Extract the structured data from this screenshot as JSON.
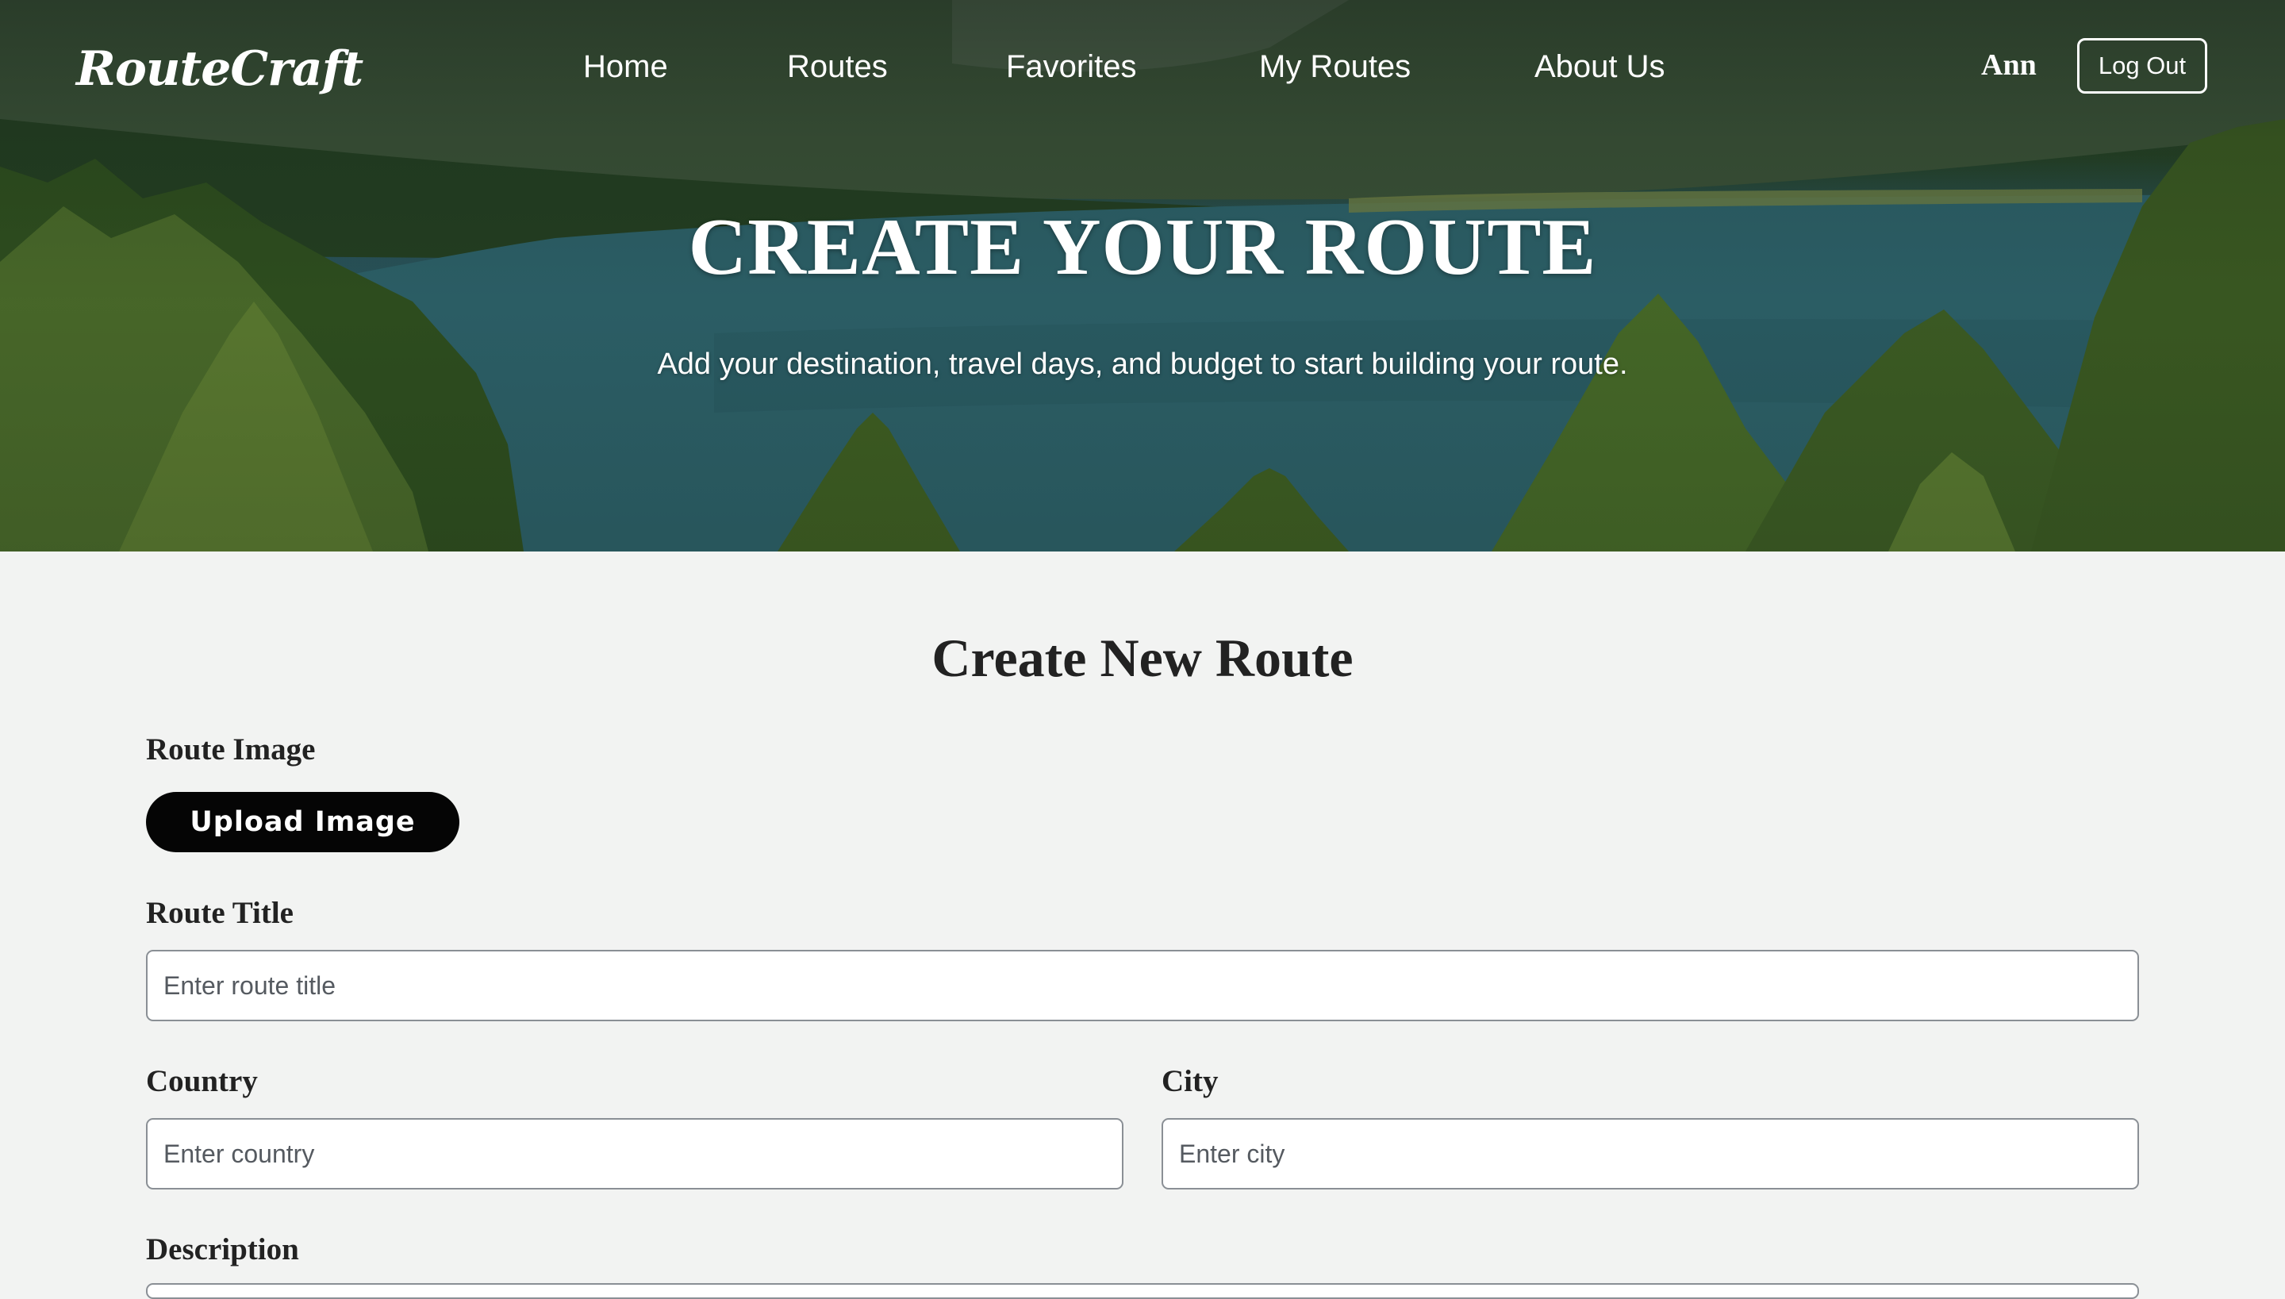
{
  "brand": {
    "logo": "RouteCraft"
  },
  "nav": {
    "items": [
      {
        "label": "Home"
      },
      {
        "label": "Routes"
      },
      {
        "label": "Favorites"
      },
      {
        "label": "My Routes"
      },
      {
        "label": "About Us"
      }
    ],
    "user_name": "Ann",
    "logout_label": "Log Out"
  },
  "hero": {
    "title": "CREATE YOUR ROUTE",
    "subtitle": "Add your destination, travel days, and budget to start building your route."
  },
  "form": {
    "heading": "Create New Route",
    "image": {
      "label": "Route Image",
      "button_label": "Upload Image"
    },
    "title": {
      "label": "Route Title",
      "placeholder": "Enter route title",
      "value": ""
    },
    "country": {
      "label": "Country",
      "placeholder": "Enter country",
      "value": ""
    },
    "city": {
      "label": "City",
      "placeholder": "Enter city",
      "value": ""
    },
    "description": {
      "label": "Description"
    }
  },
  "colors": {
    "page_background": "#f2f3f2",
    "button_dark": "#050505",
    "text_dark": "#222222",
    "input_border": "#8a8f95"
  }
}
